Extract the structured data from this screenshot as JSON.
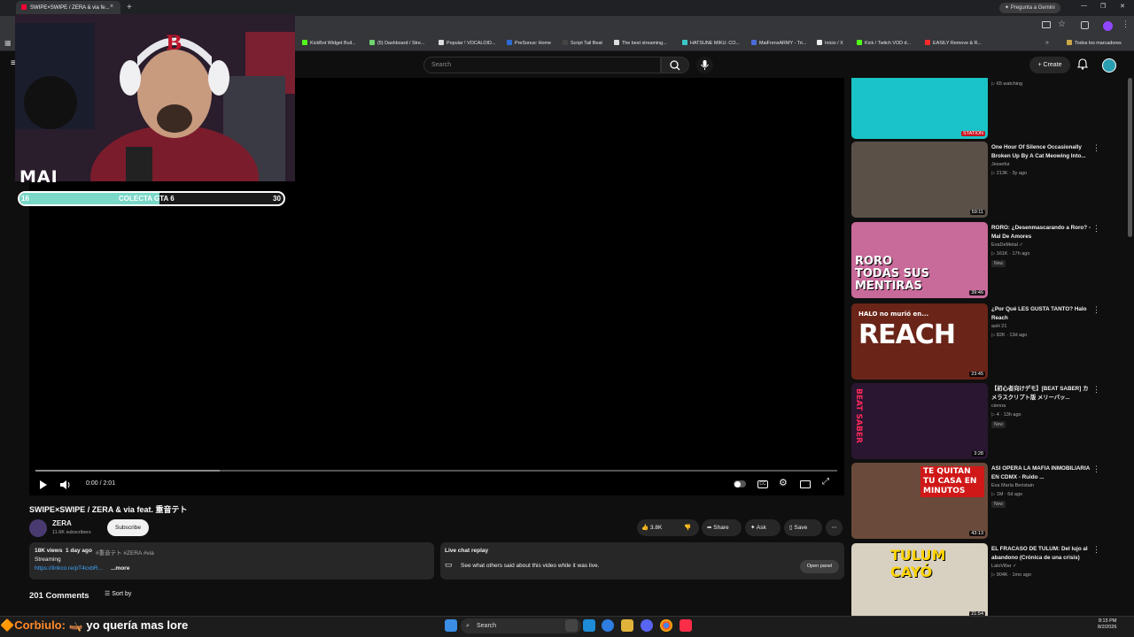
{
  "browser": {
    "tab_title": "SWIPE×SWIPE / ZERA & via fe...",
    "tab_close": "×",
    "new_tab": "+",
    "gemini_button": "✦ Pregunta a Gemini",
    "win_min": "—",
    "win_max": "❐",
    "win_close": "✕",
    "all_bookmarks": "Todos los marcadores",
    "bookmarks": [
      {
        "label": "KickBot Widget Buil...",
        "color": "#53fc18"
      },
      {
        "label": "(5) Dashboard / Stre...",
        "color": "#6fd36f"
      },
      {
        "label": "Popular ! VOCALOID...",
        "color": "#dddddd"
      },
      {
        "label": "PreSonus: Home",
        "color": "#2e6bd6"
      },
      {
        "label": "Script Tail Beat",
        "color": "#444444"
      },
      {
        "label": "The best streaming...",
        "color": "#dddddd"
      },
      {
        "label": "HATSUNE MIKU: CO...",
        "color": "#3cc8c8"
      },
      {
        "label": "MaiFrensARMY - Tri...",
        "color": "#4b6bd6"
      },
      {
        "label": "Inicio / X",
        "color": "#eeeeee"
      },
      {
        "label": "Kick / Twitch VOD d...",
        "color": "#53fc18"
      },
      {
        "label": "EASILY Remove & R...",
        "color": "#ff2a2a"
      }
    ]
  },
  "header": {
    "search_placeholder": "Search",
    "create_label": "Create"
  },
  "overlay": {
    "name": "MAI",
    "goal_label": "COLECTA GTA 6",
    "goal_current": "16",
    "goal_target": "30",
    "goal_fraction": 0.53
  },
  "player": {
    "time": "0:00 / 2:01",
    "buffered_fraction": 0.23
  },
  "video": {
    "title": "SWIPE×SWIPE / ZERA & via feat. 重音テト",
    "channel": "ZERA",
    "subscribers": "11.6K subscribers",
    "subscribe_label": "Subscribe",
    "likes": "3.8K",
    "share_label": "Share",
    "ask_label": "Ask",
    "save_label": "Save",
    "views": "18K views",
    "age": "1 day ago",
    "tags": "#重音テト #ZERA #via",
    "desc_line": "Streaming",
    "desc_link": "https://linkco.re/pT4cxbR...",
    "more_label": "...more",
    "livechat_title": "Live chat replay",
    "livechat_text": "See what others said about this video while it was live.",
    "open_panel": "Open panel",
    "comment_count": "201 Comments",
    "sort_label": "Sort by"
  },
  "recommendations": [
    {
      "title": "",
      "channel": "",
      "meta": "▷ 65 watching",
      "duration": "",
      "badge": "STATION",
      "is_new": false,
      "thumb": "#19c3c7"
    },
    {
      "title": "One Hour Of Silence Occasionally Broken Up By A Cat Meowing Into...",
      "channel": "Jessefur",
      "meta": "▷ 213K · 3y ago",
      "duration": "59:11",
      "is_new": false,
      "thumb": "#5a5048"
    },
    {
      "title": "RORO: ¿Desenmascarando a Roro? - Mal De Amores",
      "channel": "EvaDeMetal ✓",
      "meta": "▷ 161K · 17h ago",
      "duration": "39:46",
      "is_new": true,
      "thumb": "#c86a9a",
      "thumb_text": "RORO TODAS SUS MENTIRAS"
    },
    {
      "title": "¿Por Qué LES GUSTA TANTO? Halo Reach",
      "channel": "asH 21",
      "meta": "▷ 82K · 13d ago",
      "duration": "23:45",
      "is_new": false,
      "thumb": "#6a2418",
      "thumb_text": "REACH",
      "thumb_sub": "HALO no murió en..."
    },
    {
      "title": "【初心者向けデモ】[BEAT SABER] カメラスクリプト版 メリーバッ...",
      "channel": "cienna",
      "meta": "▷ 4 · 13h ago",
      "duration": "3:28",
      "is_new": true,
      "thumb": "#2a1630",
      "thumb_text": "BEAT SABER"
    },
    {
      "title": "ASI OPERA LA MAFIA INMOBILIARIA EN CDMX - Ruido ...",
      "channel": "Eva María Beristain",
      "meta": "▷ 1M · 6d ago",
      "duration": "43:13",
      "is_new": true,
      "thumb": "#6a4a3a",
      "thumb_text": "TE QUITAN TU CASA EN MINUTOS"
    },
    {
      "title": "EL FRACASO DE TULUM: Del lujo al abandono (Crónica de una crisis)",
      "channel": "LaloVillar ✓",
      "meta": "▷ 904K · 1mo ago",
      "duration": "21:54",
      "is_new": false,
      "thumb": "#d8d0c0",
      "thumb_text": "TULUM CAYÓ"
    }
  ],
  "new_badge": "New",
  "taskbar": {
    "chat_user": "Corbiulo:",
    "chat_text": "yo quería mas lore",
    "search_label": "Search",
    "time": "8:15 PM",
    "date": "8/2/2026"
  },
  "colors": {
    "accent_red": "#ff0033",
    "goal_fill": "#7ad8c8"
  }
}
